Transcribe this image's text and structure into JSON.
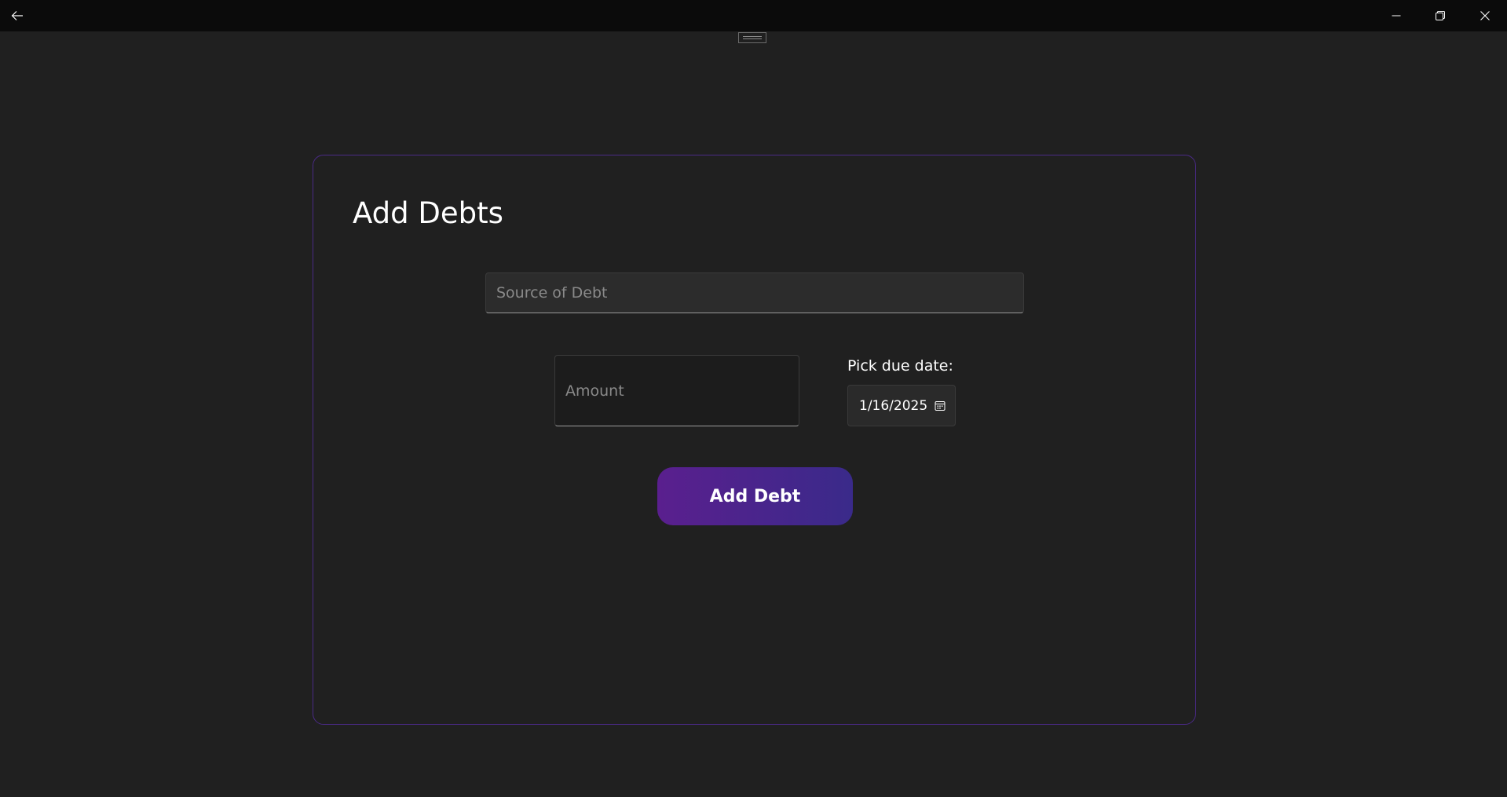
{
  "titlebar": {
    "back_icon": "back-arrow-icon",
    "minimize_icon": "minimize-icon",
    "maximize_icon": "restore-icon",
    "close_icon": "close-icon"
  },
  "form": {
    "title": "Add Debts",
    "source": {
      "value": "",
      "placeholder": "Source of Debt"
    },
    "amount": {
      "value": "",
      "placeholder": "Amount"
    },
    "due_date": {
      "label": "Pick due date:",
      "value": "1/16/2025",
      "icon": "calendar-icon"
    },
    "submit_label": "Add Debt"
  },
  "colors": {
    "background": "#202020",
    "titlebar": "#0b0b0b",
    "card_border": "#4a2a86",
    "button_gradient_start": "#5a1f8e",
    "button_gradient_end": "#3a2a8a"
  }
}
